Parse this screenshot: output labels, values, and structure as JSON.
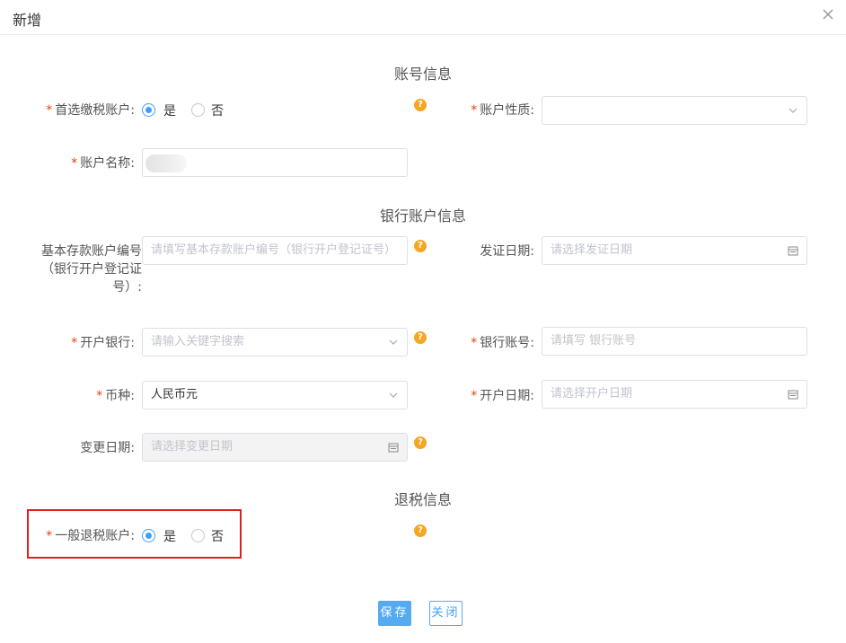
{
  "dialog": {
    "title": "新增"
  },
  "sections": {
    "account": "账号信息",
    "bank": "银行账户信息",
    "refund": "退税信息"
  },
  "required_mark": "*",
  "help_icon_text": "?",
  "fields": {
    "preferred_tax": {
      "label": "首选缴税账户:",
      "options": [
        "是",
        "否"
      ],
      "selected": "是"
    },
    "account_nature": {
      "label": "账户性质:",
      "value": ""
    },
    "account_name": {
      "label": "账户名称:",
      "value": ""
    },
    "basic_deposit_no": {
      "label": "基本存款账户编号（银行开户登记证号）:",
      "placeholder": "请填写基本存款账户编号（银行开户登记证号）"
    },
    "issue_date": {
      "label": "发证日期:",
      "placeholder": "请选择发证日期"
    },
    "opening_bank": {
      "label": "开户银行:",
      "placeholder": "请输入关键字搜索"
    },
    "bank_account_no": {
      "label": "银行账号:",
      "placeholder": "请填写 银行账号"
    },
    "currency": {
      "label": "币种:",
      "value": "人民币元"
    },
    "opening_date": {
      "label": "开户日期:",
      "placeholder": "请选择开户日期"
    },
    "change_date": {
      "label": "变更日期:",
      "placeholder": "请选择变更日期"
    },
    "general_refund": {
      "label": "一般退税账户:",
      "options": [
        "是",
        "否"
      ],
      "selected": "是"
    }
  },
  "buttons": {
    "save": "保存",
    "close": "关闭"
  },
  "icons": {
    "close": "close-icon",
    "chevron": "chevron-down-icon",
    "calendar": "calendar-icon",
    "help": "help-icon"
  },
  "colors": {
    "required": "#e5400c",
    "primary": "#409eff",
    "help": "#f5a623",
    "highlight_box": "#e02020"
  }
}
